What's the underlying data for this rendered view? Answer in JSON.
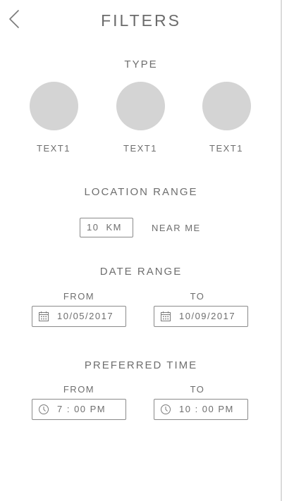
{
  "header": {
    "title": "FILTERS"
  },
  "type_section": {
    "label": "TYPE",
    "options": [
      {
        "label": "TEXT1"
      },
      {
        "label": "TEXT1"
      },
      {
        "label": "TEXT1"
      }
    ]
  },
  "location_section": {
    "label": "LOCATION RANGE",
    "distance_value": "10",
    "distance_unit": "KM",
    "near_me_label": "NEAR ME"
  },
  "date_section": {
    "label": "DATE RANGE",
    "from_label": "FROM",
    "to_label": "TO",
    "from_value": "10/05/2017",
    "to_value": "10/09/2017"
  },
  "time_section": {
    "label": "PREFERRED TIME",
    "from_label": "FROM",
    "to_label": "TO",
    "from_value": "7 : 00 PM",
    "to_value": "10 : 00 PM"
  },
  "icons": {
    "back": "chevron-left-icon",
    "date": "calendar-icon",
    "time": "clock-icon"
  }
}
